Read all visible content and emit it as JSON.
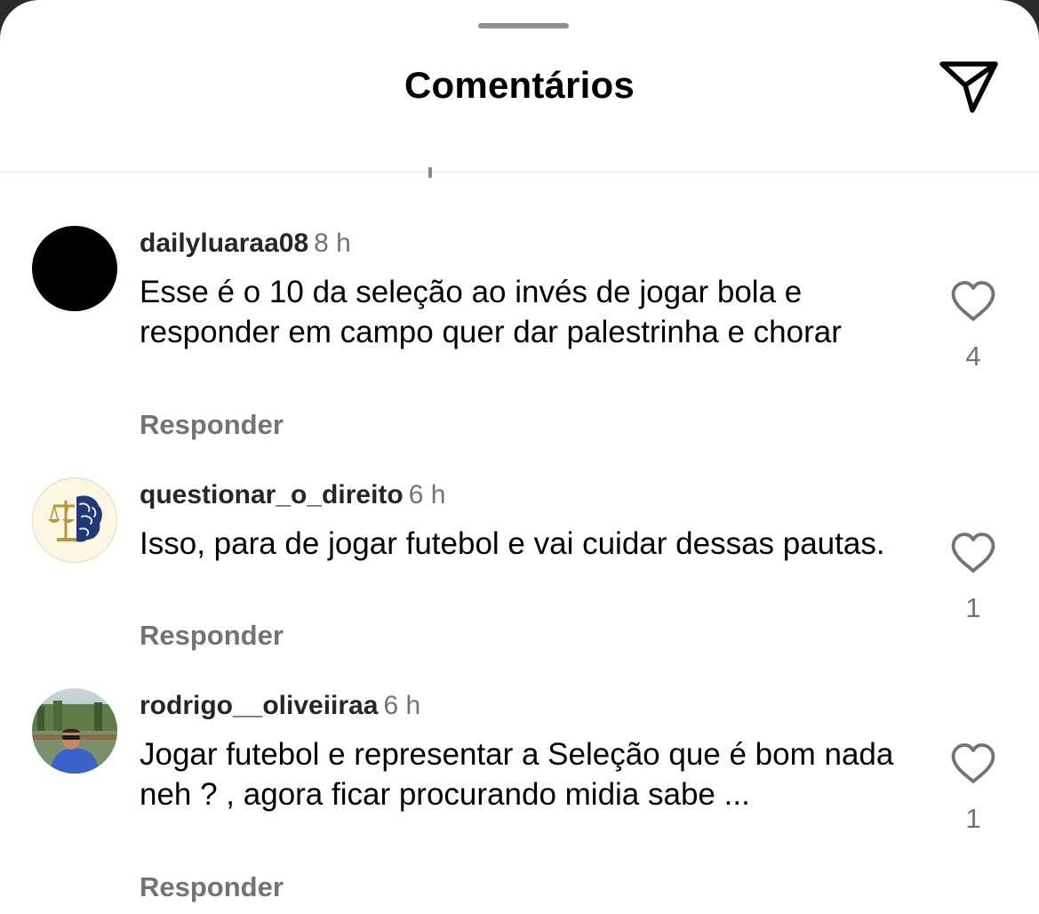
{
  "header": {
    "title": "Comentários",
    "share_icon": "paper-plane-icon"
  },
  "comments": [
    {
      "username": "dailyluaraa08",
      "time": "8 h",
      "text": "Esse é o 10 da seleção ao invés de jogar bola e responder em campo quer dar palestrinha e chorar",
      "reply_label": "Responder",
      "likes": "4",
      "avatar": "black-circle-avatar"
    },
    {
      "username": "questionar_o_direito",
      "time": "6 h",
      "text": "Isso, para de jogar futebol e vai cuidar dessas pautas.",
      "reply_label": "Responder",
      "likes": "1",
      "avatar": "scales-brain-logo-avatar"
    },
    {
      "username": "rodrigo__oliveiiraa",
      "time": "6 h",
      "text": "Jogar futebol e representar a Seleção que é bom nada neh ? , agora ficar procurando midia sabe ...",
      "reply_label": "Responder",
      "likes": "1",
      "avatar": "man-photo-avatar"
    }
  ],
  "colors": {
    "text": "#000000",
    "secondary": "#737373",
    "background": "#ffffff",
    "logo_gold": "#b8963e",
    "logo_blue": "#1f3a7a"
  }
}
